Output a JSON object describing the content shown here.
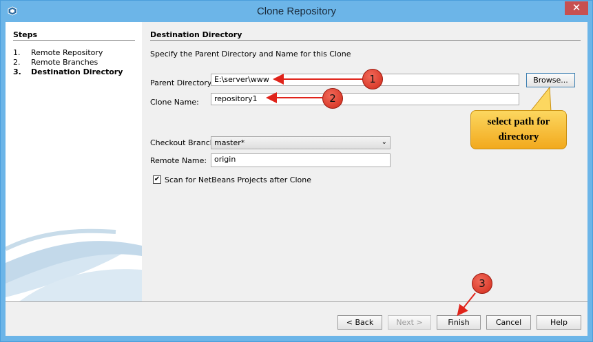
{
  "window": {
    "title": "Clone Repository",
    "close_label": "✕"
  },
  "steps": {
    "title": "Steps",
    "items": [
      {
        "num": "1.",
        "label": "Remote Repository"
      },
      {
        "num": "2.",
        "label": "Remote Branches"
      },
      {
        "num": "3.",
        "label": "Destination Directory"
      }
    ]
  },
  "main": {
    "section_title": "Destination Directory",
    "description": "Specify the Parent Directory and Name for this Clone",
    "parent_dir_label": "Parent Directory:",
    "parent_dir_value": "E:\\server\\www",
    "browse_label": "Browse...",
    "clone_name_label": "Clone Name:",
    "clone_name_value": "repository1",
    "checkout_branch_label": "Checkout Branch:",
    "checkout_branch_value": "master*",
    "remote_name_label": "Remote Name:",
    "remote_name_value": "origin",
    "scan_label": "Scan for NetBeans Projects after Clone",
    "scan_checked": true
  },
  "buttons": {
    "back": "< Back",
    "next": "Next >",
    "finish": "Finish",
    "cancel": "Cancel",
    "help": "Help"
  },
  "annotations": {
    "callout_line1": "select path for",
    "callout_line2": "directory",
    "marker1": "1",
    "marker2": "2",
    "marker3": "3"
  }
}
